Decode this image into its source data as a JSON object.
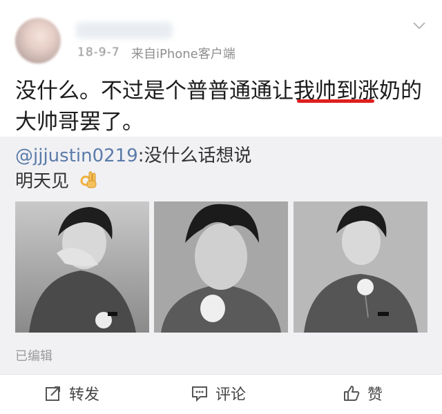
{
  "post": {
    "date": "18-9-7",
    "source": "来自iPhone客户端",
    "text": "没什么。不过是个普普通通让我帅到涨奶的大帅哥罢了。"
  },
  "repost": {
    "mention": "@jjjustin0219",
    "text": ":没什么话想说",
    "line2": "明天见",
    "edited_label": "已编辑"
  },
  "actions": {
    "forward": "转发",
    "comment": "评论",
    "like": "赞"
  },
  "colors": {
    "highlight_underline": "#e01e1e",
    "mention": "#5b7ba8",
    "repost_bg": "#f1f1f4"
  },
  "icons": [
    "chevron-down-icon",
    "ok-hand-emoji-icon",
    "forward-icon",
    "comment-icon",
    "like-icon"
  ]
}
